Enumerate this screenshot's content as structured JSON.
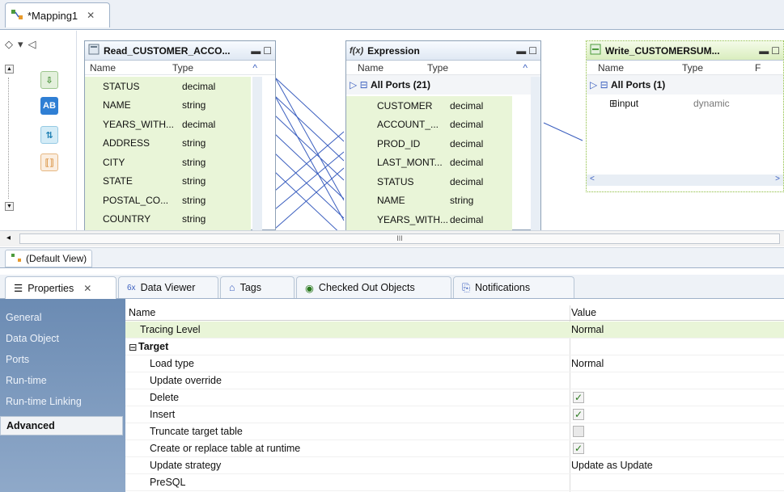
{
  "editor": {
    "tab_title": "*Mapping1",
    "close": "✕"
  },
  "palette": {
    "toolbar": [
      "◇",
      "▾",
      "◁"
    ]
  },
  "read_obj": {
    "title": "Read_CUSTOMER_ACCO...",
    "col_name": "Name",
    "col_type": "Type",
    "rows": [
      {
        "name": "STATUS",
        "type": "decimal"
      },
      {
        "name": "NAME",
        "type": "string"
      },
      {
        "name": "YEARS_WITH...",
        "type": "decimal"
      },
      {
        "name": "ADDRESS",
        "type": "string"
      },
      {
        "name": "CITY",
        "type": "string"
      },
      {
        "name": "STATE",
        "type": "string"
      },
      {
        "name": "POSTAL_CO...",
        "type": "string"
      },
      {
        "name": "COUNTRY",
        "type": "string"
      }
    ]
  },
  "expr_obj": {
    "title": "Expression",
    "col_name": "Name",
    "col_type": "Type",
    "group": "All Ports (21)",
    "rows": [
      {
        "name": "CUSTOMER",
        "type": "decimal"
      },
      {
        "name": "ACCOUNT_...",
        "type": "decimal"
      },
      {
        "name": "PROD_ID",
        "type": "decimal"
      },
      {
        "name": "LAST_MONT...",
        "type": "decimal"
      },
      {
        "name": "STATUS",
        "type": "decimal"
      },
      {
        "name": "NAME",
        "type": "string"
      },
      {
        "name": "YEARS_WITH...",
        "type": "decimal"
      }
    ]
  },
  "write_obj": {
    "title": "Write_CUSTOMERSUM...",
    "col_name": "Name",
    "col_type": "Type",
    "col_extra": "F",
    "group": "All Ports (1)",
    "rows": [
      {
        "name": "input",
        "type": "dynamic"
      }
    ]
  },
  "view_tab": "(Default View)",
  "scroll_mark": "III",
  "panel_tabs": [
    {
      "label": "Properties",
      "close": "✕"
    },
    {
      "label": "Data Viewer"
    },
    {
      "label": "Tags"
    },
    {
      "label": "Checked Out Objects"
    },
    {
      "label": "Notifications"
    }
  ],
  "sidebar": [
    "General",
    "Data Object",
    "Ports",
    "Run-time",
    "Run-time Linking",
    "Advanced"
  ],
  "table": {
    "col_name": "Name",
    "col_value": "Value",
    "rows": [
      {
        "name": "Tracing Level",
        "value": "Normal"
      },
      {
        "name": "Target",
        "value": ""
      },
      {
        "name": "Load type",
        "value": "Normal"
      },
      {
        "name": "Update override",
        "value": ""
      },
      {
        "name": "Delete",
        "checked": true
      },
      {
        "name": "Insert",
        "checked": true
      },
      {
        "name": "Truncate target table",
        "checked": false
      },
      {
        "name": "Create or replace table at runtime",
        "checked": true
      },
      {
        "name": "Update strategy",
        "value": "Update as Update"
      },
      {
        "name": "PreSQL",
        "value": ""
      }
    ]
  },
  "colors": {
    "accent": "#7da0c9",
    "link": "#3b5fbf",
    "green_row": "#e9f5d8",
    "check": "#2b7a1f"
  }
}
